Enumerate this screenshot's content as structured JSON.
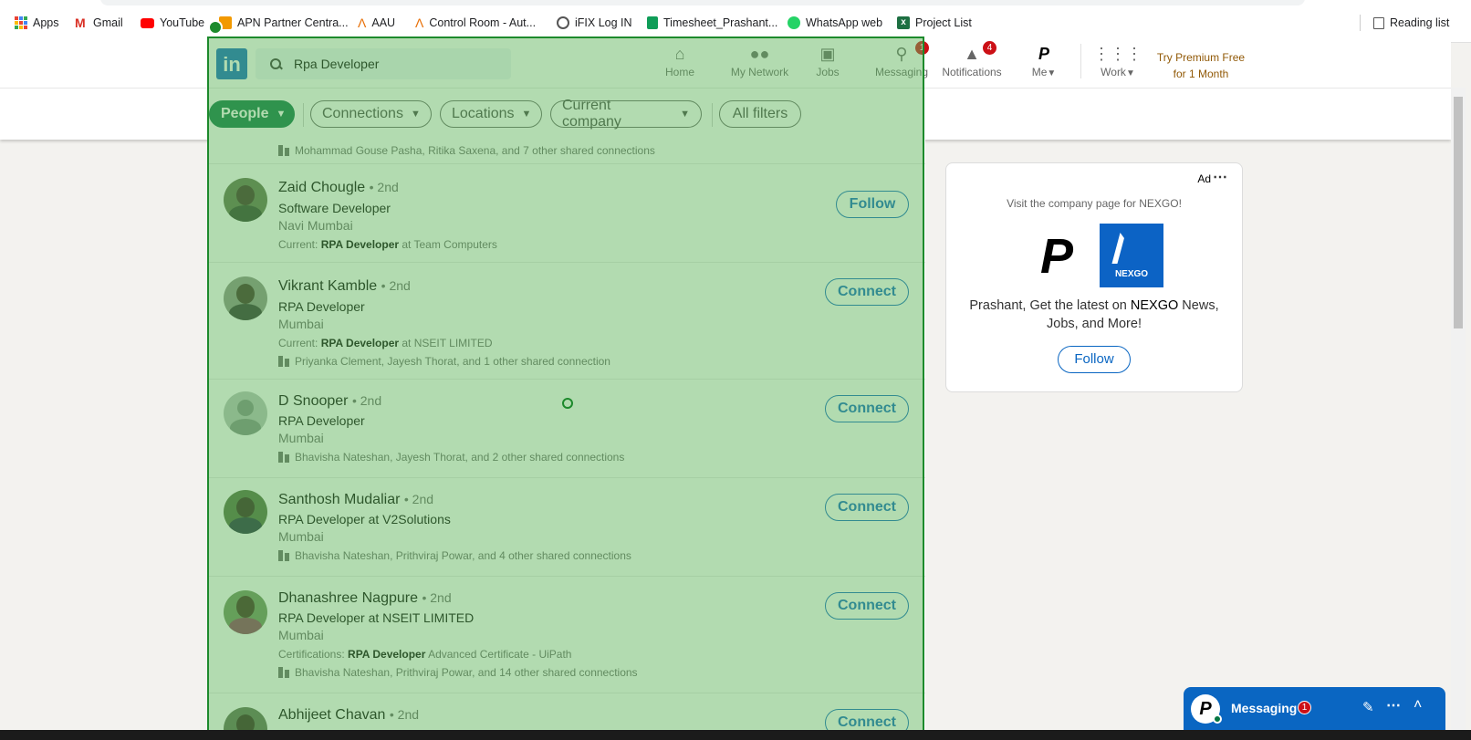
{
  "bookmarks": {
    "items": [
      "Apps",
      "Gmail",
      "YouTube",
      "APN Partner Centra...",
      "AAU",
      "Control Room - Aut...",
      "iFIX Log IN",
      "Timesheet_Prashant...",
      "WhatsApp web",
      "Project List"
    ],
    "reading_list": "Reading list"
  },
  "header": {
    "search_value": "Rpa Developer",
    "nav": {
      "home": "Home",
      "network": "My Network",
      "jobs": "Jobs",
      "messaging": "Messaging",
      "messaging_badge": "1",
      "notifications": "Notifications",
      "notifications_badge": "4",
      "me": "Me",
      "work": "Work"
    },
    "premium_line1": "Try Premium Free",
    "premium_line2": "for 1 Month"
  },
  "filters": {
    "people": "People",
    "connections": "Connections",
    "locations": "Locations",
    "current_company": "Current company",
    "all_filters": "All filters"
  },
  "results": {
    "partial_shared": "Mohammad Gouse Pasha, Ritika Saxena, and 7 other shared connections",
    "people": [
      {
        "name": "Zaid Chougle",
        "degree": "• 2nd",
        "headline": "Software Developer",
        "location": "Navi Mumbai",
        "extra_prefix": "Current: ",
        "extra_bold": "RPA Developer",
        "extra_suffix": " at Team Computers",
        "shared": "",
        "action": "Follow"
      },
      {
        "name": "Vikrant Kamble",
        "degree": "• 2nd",
        "headline": "RPA Developer",
        "location": "Mumbai",
        "extra_prefix": "Current: ",
        "extra_bold": "RPA Developer",
        "extra_suffix": " at NSEIT LIMITED",
        "shared": "Priyanka Clement, Jayesh Thorat, and 1 other shared connection",
        "action": "Connect"
      },
      {
        "name": "D Snooper",
        "degree": "• 2nd",
        "headline": "RPA Developer",
        "location": "Mumbai",
        "extra_prefix": "",
        "extra_bold": "",
        "extra_suffix": "",
        "shared": "Bhavisha Nateshan, Jayesh Thorat, and 2 other shared connections",
        "action": "Connect"
      },
      {
        "name": "Santhosh Mudaliar",
        "degree": "• 2nd",
        "headline": "RPA Developer at V2Solutions",
        "location": "Mumbai",
        "extra_prefix": "",
        "extra_bold": "",
        "extra_suffix": "",
        "shared": "Bhavisha Nateshan, Prithviraj Powar, and 4 other shared connections",
        "action": "Connect"
      },
      {
        "name": "Dhanashree Nagpure",
        "degree": "• 2nd",
        "headline": "RPA Developer at NSEIT LIMITED",
        "location": "Mumbai",
        "extra_prefix": "Certifications: ",
        "extra_bold": "RPA Developer",
        "extra_suffix": " Advanced Certificate - UiPath",
        "shared": "Bhavisha Nateshan, Prithviraj Powar, and 14 other shared connections",
        "action": "Connect"
      },
      {
        "name": "Abhijeet Chavan",
        "degree": "• 2nd",
        "headline": "",
        "location": "",
        "extra_prefix": "",
        "extra_bold": "",
        "extra_suffix": "",
        "shared": "",
        "action": "Connect"
      }
    ]
  },
  "ad": {
    "label": "Ad",
    "visit": "Visit the company page for NEXGO!",
    "logo_text": "NEXGO",
    "body_pre": "Prashant, Get the latest on ",
    "body_bold": "NEXGO",
    "body_post": " News, Jobs, and More!",
    "follow": "Follow"
  },
  "messaging": {
    "title": "Messaging",
    "badge": "1"
  },
  "colors": {
    "linkedin_blue": "#0a66c2",
    "overlay_green": "#1d8a2c",
    "badge_red": "#cc1016",
    "premium_gold": "#915907"
  }
}
